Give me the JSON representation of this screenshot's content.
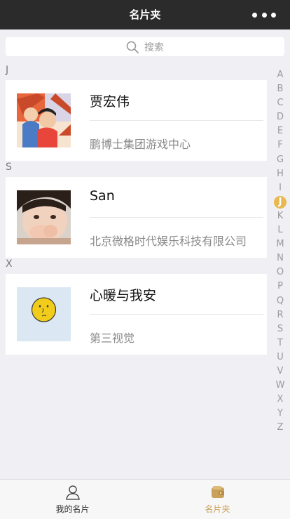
{
  "navbar": {
    "title": "名片夹",
    "more_icon": "more-dots-icon"
  },
  "search": {
    "label": "搜索",
    "icon": "search-icon"
  },
  "sections": [
    {
      "letter": "J",
      "contacts": [
        {
          "name": "贾宏伟",
          "company": "鹏博士集团游戏中心"
        }
      ]
    },
    {
      "letter": "S",
      "contacts": [
        {
          "name": "San",
          "company": "北京微格时代娱乐科技有限公司"
        }
      ]
    },
    {
      "letter": "X",
      "contacts": [
        {
          "name": "心暖与我安",
          "company": "第三视觉"
        }
      ]
    }
  ],
  "index_letters": [
    "A",
    "B",
    "C",
    "D",
    "E",
    "F",
    "G",
    "H",
    "I",
    "J",
    "K",
    "L",
    "M",
    "N",
    "O",
    "P",
    "Q",
    "R",
    "S",
    "T",
    "U",
    "V",
    "W",
    "X",
    "Y",
    "Z"
  ],
  "active_index": "J",
  "tabbar": {
    "tabs": [
      {
        "label": "我的名片",
        "icon": "user-icon",
        "active": false
      },
      {
        "label": "名片夹",
        "icon": "card-folder-icon",
        "active": true
      }
    ]
  },
  "colors": {
    "accent": "#e9b94f",
    "navbar_bg": "#2b2b2b",
    "active_tab": "#caa15a"
  }
}
